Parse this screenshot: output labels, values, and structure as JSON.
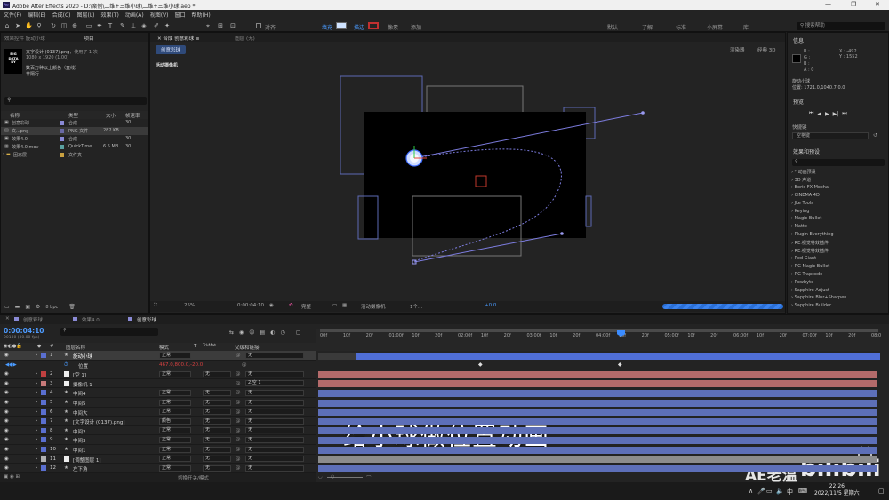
{
  "window": {
    "title": "Adobe After Effects 2020 - D:\\案例\\二维+三维小球\\二维+三维小球.aep *",
    "controls": [
      "—",
      "❐",
      "✕"
    ]
  },
  "menu": [
    "文件(F)",
    "编辑(E)",
    "合成(C)",
    "图层(L)",
    "效果(T)",
    "动画(A)",
    "视图(V)",
    "窗口",
    "帮助(H)"
  ],
  "toolbar": {
    "align_label": "对齐",
    "fill_label": "填充",
    "stroke_label": "描边",
    "stroke_value": "- 像素",
    "add_label": "添加",
    "workspaces": [
      "默认",
      "了解",
      "标准",
      "小屏幕",
      "库"
    ],
    "search_placeholder": "搜索帮助"
  },
  "project_panel": {
    "tabs": [
      "效果控件 旋动小球",
      "项目"
    ],
    "selected_item": "文字设计 (0137).png",
    "used_count": "，使用了 1 次",
    "dimensions": "1080 x 1920 (1.00)",
    "thumbnail_lines": [
      "BIG",
      "DATA",
      "RY"
    ],
    "desc_lines": [
      "数百万种以上颜色（直线）",
      "非隔行"
    ],
    "columns": [
      "名称",
      "类型",
      "大小",
      "帧速率"
    ],
    "items": [
      {
        "name": "创意彩球",
        "type": "合成",
        "size": "",
        "fps": "30",
        "color": "#8a8ad6"
      },
      {
        "name": "文...png",
        "type": "PNG 文件",
        "size": "282 KB",
        "fps": "",
        "color": "#6a6aa6"
      },
      {
        "name": "效果4.0",
        "type": "合成",
        "size": "",
        "fps": "30",
        "color": "#8a8ad6"
      },
      {
        "name": "效果4.0.mov",
        "type": "QuickTime",
        "size": "6.5 MB",
        "fps": "30",
        "color": "#5aa0a0"
      },
      {
        "name": "固态层",
        "type": "文件夹",
        "size": "",
        "fps": "",
        "color": "#c8a040"
      }
    ],
    "bpc": "8 bpc"
  },
  "viewer": {
    "tabs": [
      "合成 创意彩球",
      "图层 (无)"
    ],
    "subtab": "创意彩球",
    "renderer_label": "渲染器",
    "renderer_value": "经典 3D",
    "camera_label": "活动摄像机",
    "footer": {
      "zoom": "25%",
      "time": "0:00:04:10",
      "resolution": "完整",
      "camera": "活动摄像机",
      "views": "1个...",
      "exposure": "+0.0"
    }
  },
  "right_panel": {
    "info_title": "信息",
    "info_channels": [
      "R :",
      "G :",
      "B :",
      "A : 0"
    ],
    "coords": [
      "X : -492",
      "Y : 1552"
    ],
    "selected_layer": "旋动小球",
    "position": "位置: 1721.0,1040.7,0.0",
    "preview_title": "预览",
    "shortcut_label": "快捷键",
    "shortcut_value": "空格键",
    "effects_title": "效果和预设",
    "effects": [
      "* 动画预设",
      "3D 声道",
      "Boris FX Mocha",
      "CINEMA 4D",
      "Jke Tools",
      "Keying",
      "Magic Bullet",
      "Matte",
      "Plugin Everything",
      "RE:视觉特效插件",
      "RE:视觉特效插件",
      "Red Giant",
      "RG Magic Bullet",
      "RG Trapcode",
      "Rowbyte",
      "Sapphire Adjust",
      "Sapphire Blur+Sharpen",
      "Sapphire Builder"
    ]
  },
  "timeline": {
    "tabs": [
      "创意彩球",
      "效果4.0",
      "创意彩球"
    ],
    "current_time": "0:00:04:10",
    "frame_info": "00130 (30.00 fps)",
    "columns": [
      "图层名称",
      "模式",
      "T",
      "TrkMat",
      "父级和链接"
    ],
    "ruler_ticks": [
      "00f",
      "10f",
      "20f",
      "01:00f",
      "10f",
      "20f",
      "02:00f",
      "10f",
      "20f",
      "03:00f",
      "10f",
      "20f",
      "04:00f",
      "10f",
      "20f",
      "05:00f",
      "10f",
      "20f",
      "06:00f",
      "10f",
      "20f",
      "07:00f",
      "10f",
      "20f",
      "08:0"
    ],
    "layers": [
      {
        "num": "1",
        "name": "旋动小球",
        "mode": "正常",
        "trk": "",
        "parent": "无",
        "color": "#5a6fd0",
        "star": "★"
      },
      {
        "num": "",
        "name": "位置",
        "mode": "",
        "trk": "",
        "parent": "",
        "color": "",
        "star": "",
        "value": "467.0,800.0,-20.0"
      },
      {
        "num": "2",
        "name": "[空 1]",
        "mode": "正常",
        "trk": "无",
        "parent": "无",
        "color": "#c04040",
        "star": ""
      },
      {
        "num": "3",
        "name": "摄像机 1",
        "mode": "",
        "trk": "",
        "parent": "2.空 1",
        "color": "#c87a7a",
        "star": ""
      },
      {
        "num": "4",
        "name": "中间4",
        "mode": "正常",
        "trk": "无",
        "parent": "无",
        "color": "#5a6fd0",
        "star": "★"
      },
      {
        "num": "5",
        "name": "中间5",
        "mode": "正常",
        "trk": "无",
        "parent": "无",
        "color": "#5a6fd0",
        "star": "★"
      },
      {
        "num": "6",
        "name": "中间大",
        "mode": "正常",
        "trk": "无",
        "parent": "无",
        "color": "#5a6fd0",
        "star": "★"
      },
      {
        "num": "7",
        "name": "[文字设计 (0137).png]",
        "mode": "颜色",
        "trk": "无",
        "parent": "无",
        "color": "#5a6fd0",
        "star": "★"
      },
      {
        "num": "8",
        "name": "中间2",
        "mode": "正常",
        "trk": "无",
        "parent": "无",
        "color": "#5a6fd0",
        "star": "★"
      },
      {
        "num": "9",
        "name": "中间3",
        "mode": "正常",
        "trk": "无",
        "parent": "无",
        "color": "#5a6fd0",
        "star": "★"
      },
      {
        "num": "10",
        "name": "中间1",
        "mode": "正常",
        "trk": "无",
        "parent": "无",
        "color": "#5a6fd0",
        "star": "★"
      },
      {
        "num": "11",
        "name": "[调整图层 1]",
        "mode": "正常",
        "trk": "无",
        "parent": "无",
        "color": "#b0b0b0",
        "star": ""
      },
      {
        "num": "12",
        "name": "左下角",
        "mode": "正常",
        "trk": "无",
        "parent": "无",
        "color": "#5a6fd0",
        "star": "★"
      }
    ],
    "status": "切换开关/模式"
  },
  "overlay": {
    "subtitle": "给小球做位置动画",
    "author": "AE老温",
    "platform_logo": "bilibili"
  },
  "taskbar": {
    "ime": "中",
    "time": "22:26",
    "date": "2022/11/5 星期六"
  }
}
